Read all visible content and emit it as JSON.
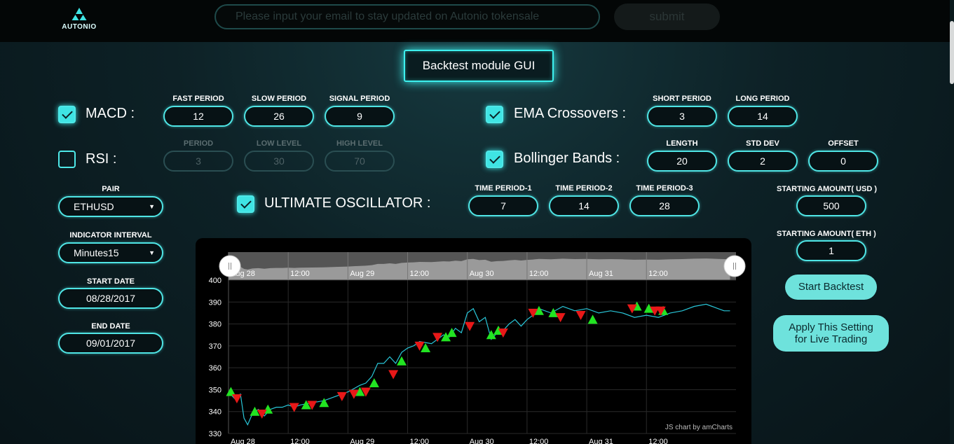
{
  "header": {
    "logo_text": "AUTONIO",
    "email_placeholder": "Please input your email to stay updated on Autonio tokensale",
    "submit_label": "submit"
  },
  "title": "Backtest module GUI",
  "macd": {
    "label": "MACD :",
    "checked": true,
    "fields": [
      {
        "label": "FAST PERIOD",
        "value": "12"
      },
      {
        "label": "SLOW PERIOD",
        "value": "26"
      },
      {
        "label": "SIGNAL PERIOD",
        "value": "9"
      }
    ]
  },
  "rsi": {
    "label": "RSI :",
    "checked": false,
    "fields": [
      {
        "label": "PERIOD",
        "value": "3"
      },
      {
        "label": "LOW LEVEL",
        "value": "30"
      },
      {
        "label": "HIGH LEVEL",
        "value": "70"
      }
    ]
  },
  "ema": {
    "label": "EMA Crossovers :",
    "checked": true,
    "fields": [
      {
        "label": "SHORT PERIOD",
        "value": "3"
      },
      {
        "label": "LONG PERIOD",
        "value": "14"
      }
    ]
  },
  "bollinger": {
    "label": "Bollinger Bands :",
    "checked": true,
    "fields": [
      {
        "label": "LENGTH",
        "value": "20"
      },
      {
        "label": "STD DEV",
        "value": "2"
      },
      {
        "label": "OFFSET",
        "value": "0"
      }
    ]
  },
  "ultimate": {
    "label": "ULTIMATE OSCILLATOR :",
    "checked": true,
    "fields": [
      {
        "label": "TIME PERIOD-1",
        "value": "7"
      },
      {
        "label": "TIME PERIOD-2",
        "value": "14"
      },
      {
        "label": "TIME PERIOD-3",
        "value": "28"
      }
    ]
  },
  "left_panel": {
    "pair_label": "PAIR",
    "pair_value": "ETHUSD",
    "interval_label": "INDICATOR INTERVAL",
    "interval_value": "Minutes15",
    "start_label": "START DATE",
    "start_value": "08/28/2017",
    "end_label": "END DATE",
    "end_value": "09/01/2017"
  },
  "right_panel": {
    "usd_label": "STARTING AMOUNT( USD )",
    "usd_value": "500",
    "eth_label": "STARTING AMOUNT( ETH )",
    "eth_value": "1",
    "start_backtest": "Start Backtest",
    "apply_line1": "Apply This Setting",
    "apply_line2": "for Live Trading"
  },
  "colors": {
    "accent": "#4fe5e5",
    "buy": "#22e422",
    "sell": "#e81818",
    "line": "#29c6d8"
  },
  "chart_data": {
    "type": "line",
    "credit": "JS chart by amCharts",
    "ylim": [
      330,
      400
    ],
    "yticks": [
      330,
      340,
      350,
      360,
      370,
      380,
      390,
      400
    ],
    "x_tick_labels": [
      "Aug 28",
      "12:00",
      "Aug 29",
      "12:00",
      "Aug 30",
      "12:00",
      "Aug 31",
      "12:00"
    ],
    "x_tick_positions": [
      0.5,
      1,
      1.5,
      2,
      2.5,
      3,
      3.5,
      4
    ],
    "xlim": [
      0.5,
      4.75
    ],
    "series": [
      {
        "x": [
          0.5,
          0.55,
          0.6,
          0.63,
          0.66,
          0.7,
          0.75,
          0.8,
          0.85,
          0.9,
          0.95,
          1.0,
          1.05,
          1.1,
          1.2,
          1.3,
          1.4,
          1.5,
          1.6,
          1.65,
          1.7,
          1.75,
          1.8,
          1.85,
          1.9,
          1.95,
          2.0,
          2.05,
          2.1,
          2.2,
          2.3,
          2.35,
          2.4,
          2.45,
          2.5,
          2.55,
          2.6,
          2.65,
          2.7,
          2.75,
          2.8,
          2.85,
          2.9,
          2.95,
          3.0,
          3.05,
          3.1,
          3.2,
          3.3,
          3.4,
          3.5,
          3.6,
          3.7,
          3.8,
          3.9,
          4.0,
          4.1,
          4.2,
          4.3,
          4.4,
          4.5,
          4.55,
          4.6,
          4.65,
          4.7
        ],
        "y": [
          349,
          346,
          348,
          337,
          334,
          339,
          341,
          338,
          341,
          342,
          342,
          343,
          342,
          343,
          344,
          345,
          347,
          349,
          352,
          353,
          356,
          362,
          362,
          365,
          362,
          367,
          369,
          370,
          372,
          371,
          375,
          374,
          378,
          376,
          385,
          387,
          381,
          383,
          373,
          376,
          377,
          380,
          382,
          379,
          382,
          384,
          387,
          385,
          388,
          386,
          387,
          385,
          386,
          385,
          383,
          384,
          383,
          385,
          386,
          388,
          389,
          388,
          387,
          386,
          386
        ]
      }
    ],
    "buy_signals": [
      [
        0.52,
        349
      ],
      [
        0.72,
        340
      ],
      [
        0.83,
        341
      ],
      [
        1.15,
        343
      ],
      [
        1.3,
        344
      ],
      [
        1.6,
        349
      ],
      [
        1.72,
        353
      ],
      [
        1.95,
        363
      ],
      [
        2.15,
        369
      ],
      [
        2.32,
        374
      ],
      [
        2.37,
        376
      ],
      [
        2.7,
        375
      ],
      [
        2.76,
        377
      ],
      [
        3.1,
        386
      ],
      [
        3.22,
        385
      ],
      [
        3.55,
        382
      ],
      [
        3.92,
        388
      ],
      [
        4.02,
        387
      ],
      [
        4.14,
        386
      ]
    ],
    "sell_signals": [
      [
        0.57,
        346
      ],
      [
        0.78,
        339
      ],
      [
        1.05,
        342
      ],
      [
        1.2,
        343
      ],
      [
        1.45,
        347
      ],
      [
        1.55,
        348
      ],
      [
        1.65,
        349
      ],
      [
        1.88,
        357
      ],
      [
        2.1,
        370
      ],
      [
        2.25,
        374
      ],
      [
        2.52,
        379
      ],
      [
        2.8,
        376
      ],
      [
        3.05,
        385
      ],
      [
        3.28,
        383
      ],
      [
        3.45,
        384
      ],
      [
        3.88,
        387
      ],
      [
        4.07,
        386
      ],
      [
        4.12,
        386
      ]
    ]
  }
}
